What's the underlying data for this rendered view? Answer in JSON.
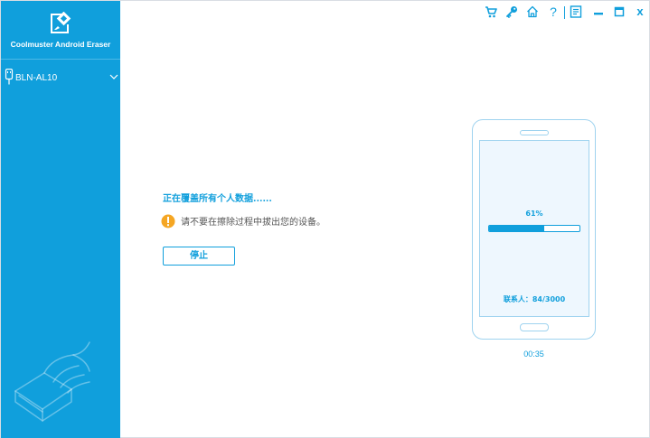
{
  "app": {
    "name": "Coolmuster Android Eraser"
  },
  "sidebar": {
    "device": {
      "name": "BLN-AL10",
      "icon": "usb-phone-icon"
    }
  },
  "toolbar": {
    "icons": [
      "cart-icon",
      "key-icon",
      "home-icon",
      "help-icon",
      "feedback-icon",
      "minimize-icon",
      "maximize-icon",
      "close-icon"
    ],
    "help_label": "?",
    "close_label": "x"
  },
  "main": {
    "status_title": "正在覆盖所有个人数据......",
    "warning_text": "请不要在擦除过程中拔出您的设备。",
    "stop_button_label": "停止"
  },
  "progress": {
    "percent_label": "61%",
    "percent_value": 61,
    "contacts_line": "联系人：84/3000",
    "elapsed": "00:35"
  },
  "colors": {
    "accent": "#109fdc",
    "phone_outline": "#9fd3ef",
    "warning": "#f5a623"
  }
}
